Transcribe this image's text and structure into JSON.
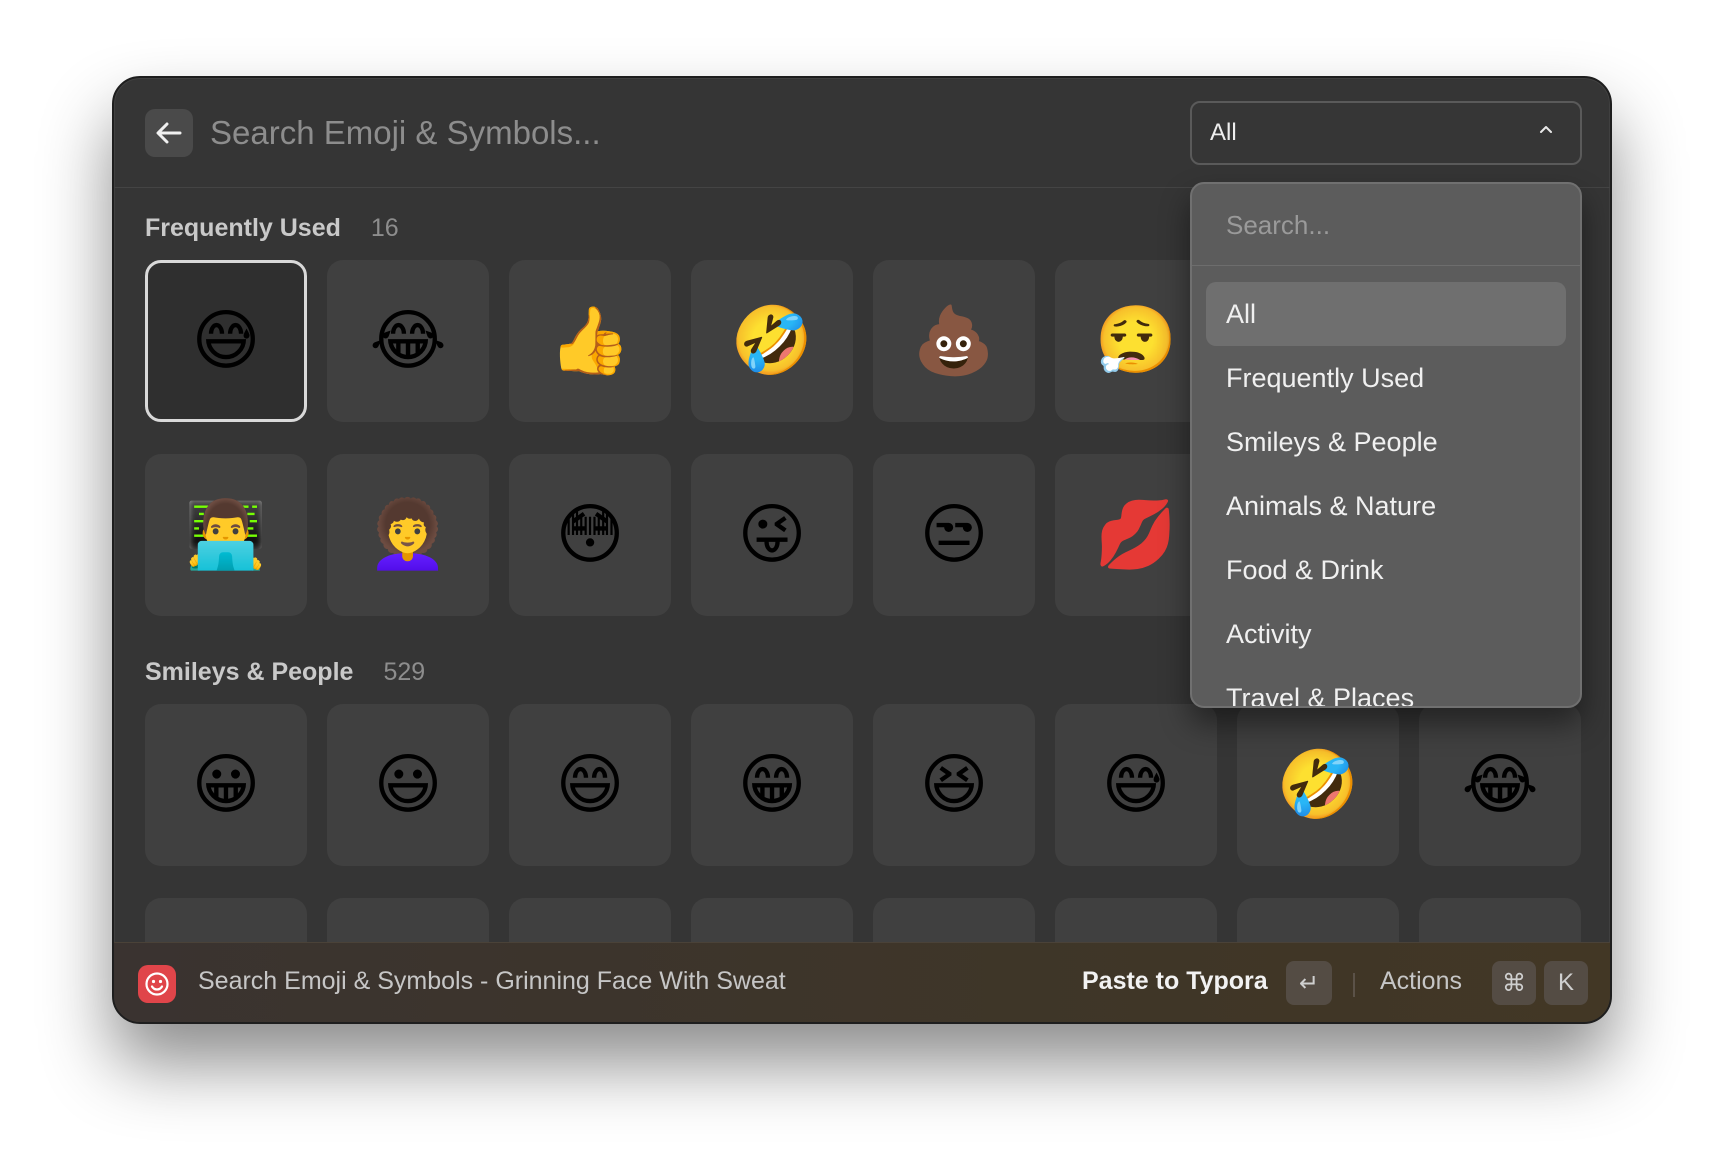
{
  "header": {
    "search_placeholder": "Search Emoji & Symbols...",
    "category_value": "All"
  },
  "sections": [
    {
      "title": "Frequently Used",
      "count": "16",
      "emojis": [
        "😅",
        "😂",
        "👍",
        "🤣",
        "💩",
        "😮‍💨",
        "👨‍💻",
        "👩‍🦱",
        "😳",
        "😜",
        "😒",
        "💋"
      ]
    },
    {
      "title": "Smileys & People",
      "count": "529",
      "emojis": [
        "😀",
        "😃",
        "😄",
        "😁",
        "😆",
        "😅",
        "🤣",
        "😂"
      ]
    }
  ],
  "dropdown": {
    "search_placeholder": "Search...",
    "items": [
      "All",
      "Frequently Used",
      "Smileys & People",
      "Animals & Nature",
      "Food & Drink",
      "Activity",
      "Travel & Places"
    ]
  },
  "footer": {
    "title": "Search Emoji & Symbols - Grinning Face With Sweat",
    "primary_action": "Paste to Typora",
    "enter_key": "↵",
    "actions_label": "Actions",
    "cmd_key": "⌘",
    "k_key": "K"
  },
  "colors": {
    "window_bg": "#353535",
    "tile_bg": "#404040",
    "dropdown_bg": "#5c5c5c",
    "app_icon": "#e0454a"
  }
}
